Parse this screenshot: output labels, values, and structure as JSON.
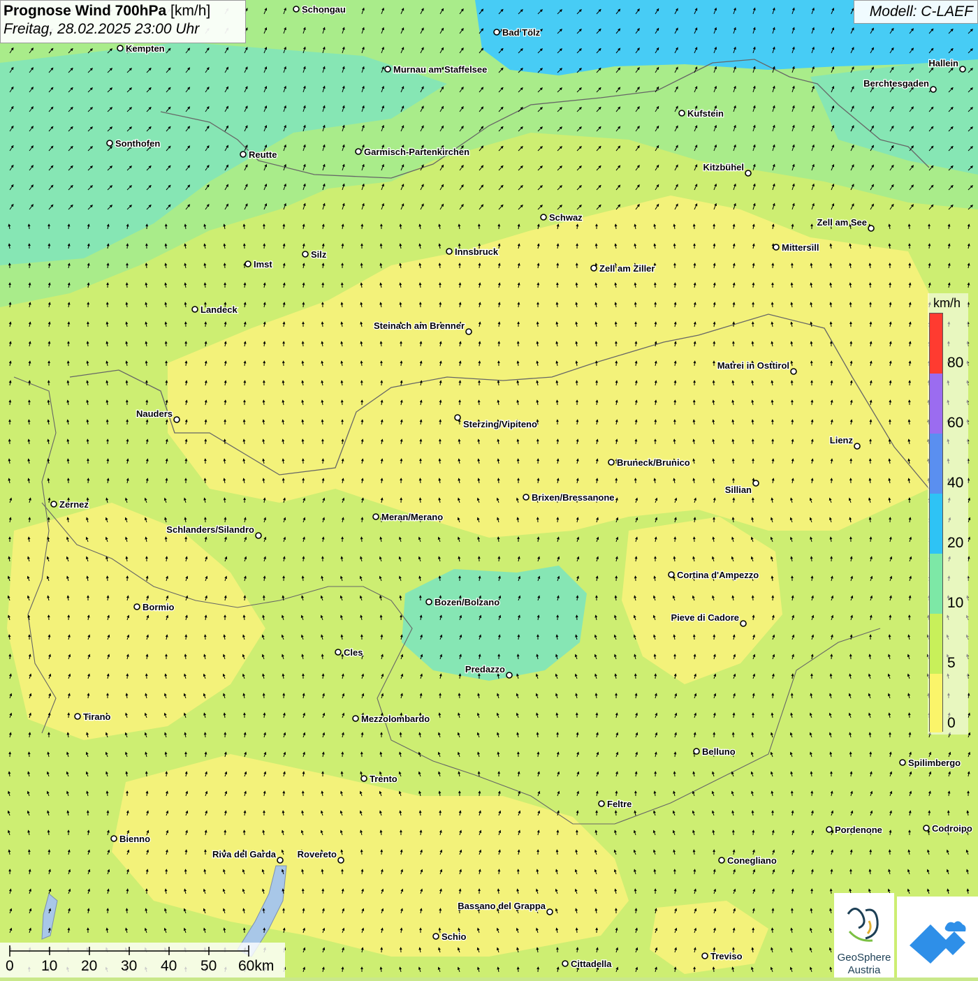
{
  "header": {
    "title_bold": "Prognose Wind 700hPa",
    "title_unit": "[km/h]",
    "datetime": "Freitag, 28.02.2025 23:00 Uhr"
  },
  "model": "Modell: C-LAEF",
  "legend": {
    "unit": "km/h",
    "labels": [
      "80",
      "60",
      "40",
      "20",
      "10",
      "5",
      "0"
    ],
    "colors": [
      "#ff3b30",
      "#9b6cf0",
      "#5a8ff0",
      "#2ec3f5",
      "#7de8a6",
      "#c8f05a",
      "#fbf56a"
    ]
  },
  "scale_bar": {
    "labels": [
      "0",
      "10",
      "20",
      "30",
      "40",
      "50",
      "60km"
    ]
  },
  "map_colors": {
    "yellow": "#f3f27a",
    "lightgreen": "#cdee72",
    "green": "#a9ec8a",
    "teal": "#86e6b4",
    "blue": "#47ccf5",
    "arrows": "#000000",
    "borders": "#666666"
  },
  "cities": [
    {
      "name": "Schongau"
    },
    {
      "name": "Bad Tölz"
    },
    {
      "name": "Kempten"
    },
    {
      "name": "Murnau am Staffelsee"
    },
    {
      "name": "Hallein"
    },
    {
      "name": "Berchtesgaden"
    },
    {
      "name": "Kufstein"
    },
    {
      "name": "Sonthofen"
    },
    {
      "name": "Reutte"
    },
    {
      "name": "Garmisch-Partenkirchen"
    },
    {
      "name": "Kitzbühel"
    },
    {
      "name": "Schwaz"
    },
    {
      "name": "Zell am See"
    },
    {
      "name": "Mittersill"
    },
    {
      "name": "Innsbruck"
    },
    {
      "name": "Silz"
    },
    {
      "name": "Imst"
    },
    {
      "name": "Zell am Ziller"
    },
    {
      "name": "Landeck"
    },
    {
      "name": "Steinach am Brenner"
    },
    {
      "name": "Matrei in Osttirol"
    },
    {
      "name": "Nauders"
    },
    {
      "name": "Sterzing/Vipiteno"
    },
    {
      "name": "Lienz"
    },
    {
      "name": "Bruneck/Brunico"
    },
    {
      "name": "Sillian"
    },
    {
      "name": "Brixen/Bressanone"
    },
    {
      "name": "Zernez"
    },
    {
      "name": "Meran/Merano"
    },
    {
      "name": "Schlanders/Silandro"
    },
    {
      "name": "Cortina d'Ampezzo"
    },
    {
      "name": "Bozen/Bolzano"
    },
    {
      "name": "Bormio"
    },
    {
      "name": "Pieve di Cadore"
    },
    {
      "name": "Cles"
    },
    {
      "name": "Predazzo"
    },
    {
      "name": "Tirano"
    },
    {
      "name": "Mezzolombardo"
    },
    {
      "name": "Belluno"
    },
    {
      "name": "Spilimbergo"
    },
    {
      "name": "Trento"
    },
    {
      "name": "Feltre"
    },
    {
      "name": "Pordenone"
    },
    {
      "name": "Codroipo"
    },
    {
      "name": "Bienno"
    },
    {
      "name": "Riva del Garda"
    },
    {
      "name": "Rovereto"
    },
    {
      "name": "Conegliano"
    },
    {
      "name": "Bassano del Grappa"
    },
    {
      "name": "Schio"
    },
    {
      "name": "Treviso"
    },
    {
      "name": "Cittadella"
    }
  ],
  "logos": {
    "geosphere_line1": "GeoSphere",
    "geosphere_line2": "Austria"
  }
}
